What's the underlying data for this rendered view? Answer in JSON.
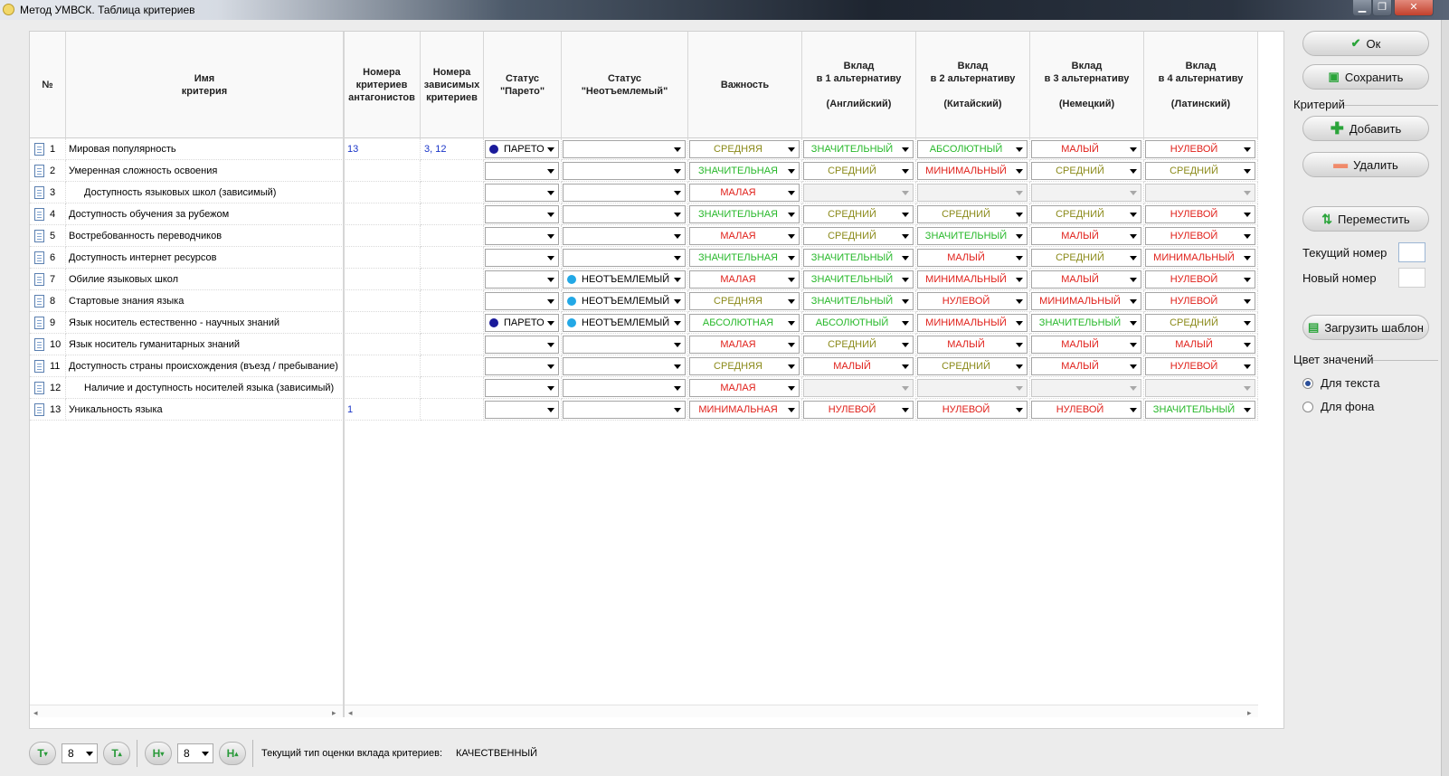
{
  "window": {
    "title": "Метод УМВСК. Таблица критериев",
    "min": "▁",
    "max": "❐",
    "close": "✕"
  },
  "colors": {
    "green": "#27b82a",
    "olive": "#8b8a1a",
    "red": "#e0201a",
    "pareto_dot": "#1a1a9a",
    "integral_dot": "#22a8e6"
  },
  "headers": {
    "num": "№",
    "name": "Имя\nкритерия",
    "antag": "Номера\nкритериев\nантагонистов",
    "dep": "Номера\nзависимых\nкритериев",
    "pareto": "Статус\n\"Парето\"",
    "integral": "Статус\n\"Неотъемлемый\"",
    "importance": "Важность",
    "alt1": "Вклад\nв 1 альтернативу\n\n(Английский)",
    "alt2": "Вклад\nв 2 альтернативу\n\n(Китайский)",
    "alt3": "Вклад\nв 3 альтернативу\n\n(Немецкий)",
    "alt4": "Вклад\nв 4 альтернативу\n\n(Латинский)"
  },
  "rows": [
    {
      "n": "1",
      "name": "Мировая популярность",
      "indent": false,
      "antag": "13",
      "dep": "3, 12",
      "pareto": "ПАРЕТО",
      "integral": "",
      "imp": "СРЕДНЯЯ",
      "imp_c": "o",
      "a1": "ЗНАЧИТЕЛЬНЫЙ",
      "a1_c": "g",
      "a2": "АБСОЛЮТНЫЙ",
      "a2_c": "g",
      "a3": "МАЛЫЙ",
      "a3_c": "r",
      "a4": "НУЛЕВОЙ",
      "a4_c": "r"
    },
    {
      "n": "2",
      "name": "Умеренная сложность  освоения",
      "indent": false,
      "antag": "",
      "dep": "",
      "pareto": "",
      "integral": "",
      "imp": "ЗНАЧИТЕЛЬНАЯ",
      "imp_c": "g",
      "a1": "СРЕДНИЙ",
      "a1_c": "o",
      "a2": "МИНИМАЛЬНЫЙ",
      "a2_c": "r",
      "a3": "СРЕДНИЙ",
      "a3_c": "o",
      "a4": "СРЕДНИЙ",
      "a4_c": "o"
    },
    {
      "n": "3",
      "name": "Доступность языковых школ (зависимый)",
      "indent": true,
      "antag": "",
      "dep": "",
      "pareto": "",
      "integral": "",
      "imp": "МАЛАЯ",
      "imp_c": "r",
      "a1": "",
      "a1_c": "",
      "a2": "",
      "a2_c": "",
      "a3": "",
      "a3_c": "",
      "a4": "",
      "a4_c": "",
      "disabled": true
    },
    {
      "n": "4",
      "name": "Доступность обучения за рубежом",
      "indent": false,
      "antag": "",
      "dep": "",
      "pareto": "",
      "integral": "",
      "imp": "ЗНАЧИТЕЛЬНАЯ",
      "imp_c": "g",
      "a1": "СРЕДНИЙ",
      "a1_c": "o",
      "a2": "СРЕДНИЙ",
      "a2_c": "o",
      "a3": "СРЕДНИЙ",
      "a3_c": "o",
      "a4": "НУЛЕВОЙ",
      "a4_c": "r"
    },
    {
      "n": "5",
      "name": "Востребованность переводчиков",
      "indent": false,
      "antag": "",
      "dep": "",
      "pareto": "",
      "integral": "",
      "imp": "МАЛАЯ",
      "imp_c": "r",
      "a1": "СРЕДНИЙ",
      "a1_c": "o",
      "a2": "ЗНАЧИТЕЛЬНЫЙ",
      "a2_c": "g",
      "a3": "МАЛЫЙ",
      "a3_c": "r",
      "a4": "НУЛЕВОЙ",
      "a4_c": "r"
    },
    {
      "n": "6",
      "name": "Доступность интернет ресурсов",
      "indent": false,
      "antag": "",
      "dep": "",
      "pareto": "",
      "integral": "",
      "imp": "ЗНАЧИТЕЛЬНАЯ",
      "imp_c": "g",
      "a1": "ЗНАЧИТЕЛЬНЫЙ",
      "a1_c": "g",
      "a2": "МАЛЫЙ",
      "a2_c": "r",
      "a3": "СРЕДНИЙ",
      "a3_c": "o",
      "a4": "МИНИМАЛЬНЫЙ",
      "a4_c": "r"
    },
    {
      "n": "7",
      "name": "Обилие языковых школ",
      "indent": false,
      "antag": "",
      "dep": "",
      "pareto": "",
      "integral": "НЕОТЪЕМЛЕМЫЙ",
      "imp": "МАЛАЯ",
      "imp_c": "r",
      "a1": "ЗНАЧИТЕЛЬНЫЙ",
      "a1_c": "g",
      "a2": "МИНИМАЛЬНЫЙ",
      "a2_c": "r",
      "a3": "МАЛЫЙ",
      "a3_c": "r",
      "a4": "НУЛЕВОЙ",
      "a4_c": "r"
    },
    {
      "n": "8",
      "name": "Стартовые знания языка",
      "indent": false,
      "antag": "",
      "dep": "",
      "pareto": "",
      "integral": "НЕОТЪЕМЛЕМЫЙ",
      "imp": "СРЕДНЯЯ",
      "imp_c": "o",
      "a1": "ЗНАЧИТЕЛЬНЫЙ",
      "a1_c": "g",
      "a2": "НУЛЕВОЙ",
      "a2_c": "r",
      "a3": "МИНИМАЛЬНЫЙ",
      "a3_c": "r",
      "a4": "НУЛЕВОЙ",
      "a4_c": "r"
    },
    {
      "n": "9",
      "name": "Язык носитель естественно - научных знаний",
      "indent": false,
      "antag": "",
      "dep": "",
      "pareto": "ПАРЕТО",
      "integral": "НЕОТЪЕМЛЕМЫЙ",
      "imp": "АБСОЛЮТНАЯ",
      "imp_c": "g",
      "a1": "АБСОЛЮТНЫЙ",
      "a1_c": "g",
      "a2": "МИНИМАЛЬНЫЙ",
      "a2_c": "r",
      "a3": "ЗНАЧИТЕЛЬНЫЙ",
      "a3_c": "g",
      "a4": "СРЕДНИЙ",
      "a4_c": "o"
    },
    {
      "n": "10",
      "name": "Язык носитель гуманитарных знаний",
      "indent": false,
      "antag": "",
      "dep": "",
      "pareto": "",
      "integral": "",
      "imp": "МАЛАЯ",
      "imp_c": "r",
      "a1": "СРЕДНИЙ",
      "a1_c": "o",
      "a2": "МАЛЫЙ",
      "a2_c": "r",
      "a3": "МАЛЫЙ",
      "a3_c": "r",
      "a4": "МАЛЫЙ",
      "a4_c": "r"
    },
    {
      "n": "11",
      "name": "Доступность страны происхождения (въезд / пребывание)",
      "indent": false,
      "antag": "",
      "dep": "",
      "pareto": "",
      "integral": "",
      "imp": "СРЕДНЯЯ",
      "imp_c": "o",
      "a1": "МАЛЫЙ",
      "a1_c": "r",
      "a2": "СРЕДНИЙ",
      "a2_c": "o",
      "a3": "МАЛЫЙ",
      "a3_c": "r",
      "a4": "НУЛЕВОЙ",
      "a4_c": "r"
    },
    {
      "n": "12",
      "name": "Наличие и доступность носителей языка (зависимый)",
      "indent": true,
      "antag": "",
      "dep": "",
      "pareto": "",
      "integral": "",
      "imp": "МАЛАЯ",
      "imp_c": "r",
      "a1": "",
      "a1_c": "",
      "a2": "",
      "a2_c": "",
      "a3": "",
      "a3_c": "",
      "a4": "",
      "a4_c": "",
      "disabled": true
    },
    {
      "n": "13",
      "name": "Уникальность языка",
      "indent": false,
      "antag": "1",
      "dep": "",
      "pareto": "",
      "integral": "",
      "imp": "МИНИМАЛЬНАЯ",
      "imp_c": "r",
      "a1": "НУЛЕВОЙ",
      "a1_c": "r",
      "a2": "НУЛЕВОЙ",
      "a2_c": "r",
      "a3": "НУЛЕВОЙ",
      "a3_c": "r",
      "a4": "ЗНАЧИТЕЛЬНЫЙ",
      "a4_c": "g"
    }
  ],
  "sidebar": {
    "ok": "Ок",
    "save": "Сохранить",
    "criterion_group": "Критерий",
    "add": "Добавить",
    "delete": "Удалить",
    "move": "Переместить",
    "current_number": "Текущий номер",
    "new_number": "Новый номер",
    "load_template": "Загрузить шаблон",
    "color_group": "Цвет значений",
    "for_text": "Для текста",
    "for_bg": "Для фона"
  },
  "bottom": {
    "t_minus": "T",
    "t_value": "8",
    "t_plus": "T",
    "h_minus": "H",
    "h_value": "8",
    "h_plus": "H",
    "status_label": "Текущий тип оценки вклада критериев:",
    "status_value": "КАЧЕСТВЕННЫЙ"
  },
  "icons": {
    "ok": "check-icon",
    "save": "floppy-icon",
    "add": "plus-icon",
    "delete": "minus-icon",
    "move": "move-icon",
    "template": "template-icon"
  }
}
